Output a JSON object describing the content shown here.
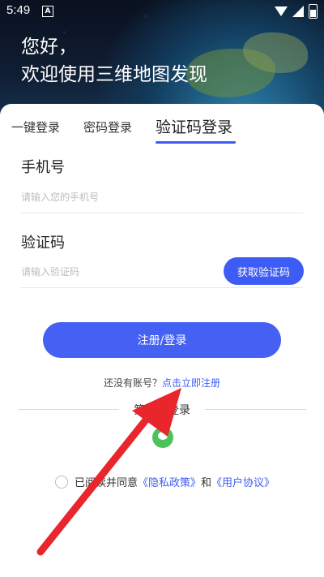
{
  "status_bar": {
    "time": "5:49",
    "notification_badge": "A"
  },
  "hero": {
    "line1": "您好，",
    "line2": "欢迎使用三维地图发现"
  },
  "tabs": [
    {
      "label": "一键登录"
    },
    {
      "label": "密码登录"
    },
    {
      "label": "验证码登录",
      "active": true
    }
  ],
  "phone": {
    "label": "手机号",
    "placeholder": "请输入您的手机号",
    "value": ""
  },
  "code": {
    "label": "验证码",
    "placeholder": "请输入验证码",
    "value": "",
    "get_code_button": "获取验证码"
  },
  "submit_button": "注册/登录",
  "register": {
    "prompt": "还没有账号？",
    "link": "点击立即注册"
  },
  "third_party": {
    "title": "第三方登录",
    "providers": [
      {
        "icon": "wechat-icon"
      }
    ]
  },
  "agreement": {
    "checked": false,
    "prefix": "已阅读并同意",
    "privacy": "《隐私政策》",
    "and": "和",
    "terms": "《用户协议》"
  },
  "colors": {
    "accent": "#3d5cf5",
    "annotation_arrow": "#e8262b"
  }
}
